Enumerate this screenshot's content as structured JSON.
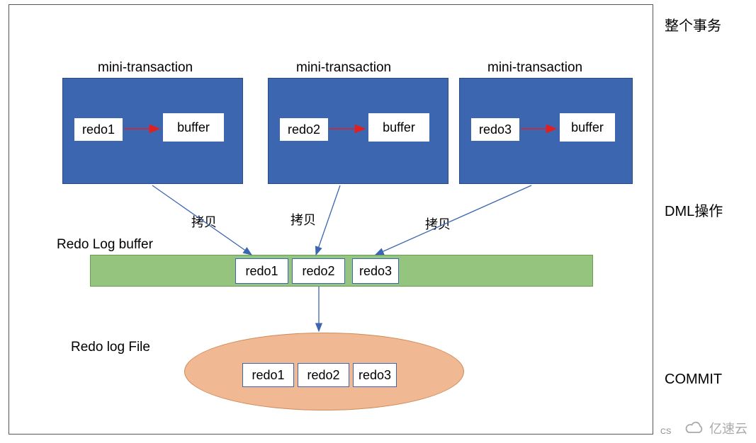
{
  "outerTitle": "整个事务",
  "phases": {
    "dml": "DML操作",
    "commit": "COMMIT"
  },
  "miniTransactions": [
    {
      "title": "mini-transaction",
      "redo": "redo1",
      "buffer": "buffer"
    },
    {
      "title": "mini-transaction",
      "redo": "redo2",
      "buffer": "buffer"
    },
    {
      "title": "mini-transaction",
      "redo": "redo3",
      "buffer": "buffer"
    }
  ],
  "copyLabel": "拷贝",
  "redoLogBuffer": {
    "title": "Redo Log buffer",
    "slots": [
      "redo1",
      "redo2",
      "redo3"
    ]
  },
  "redoLogFile": {
    "title": "Redo log File",
    "slots": [
      "redo1",
      "redo2",
      "redo3"
    ]
  },
  "watermark": "亿速云",
  "cs": "CS"
}
